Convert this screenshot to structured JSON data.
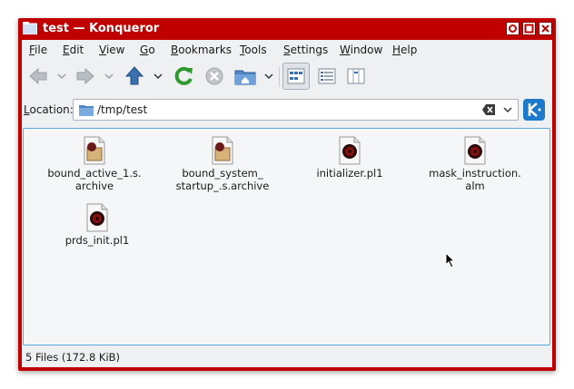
{
  "window": {
    "title": "test — Konqueror",
    "buttons": [
      "pin",
      "maximize",
      "close"
    ]
  },
  "menubar": {
    "items": [
      {
        "first": "F",
        "rest": "ile"
      },
      {
        "first": "E",
        "rest": "dit"
      },
      {
        "first": "V",
        "rest": "iew"
      },
      {
        "first": "G",
        "rest": "o"
      },
      {
        "first": "B",
        "rest": "ookmarks"
      },
      {
        "first": "T",
        "rest": "ools"
      },
      {
        "first": "S",
        "rest": "ettings"
      },
      {
        "first": "W",
        "rest": "indow"
      },
      {
        "first": "H",
        "rest": "elp"
      }
    ]
  },
  "toolbar": {
    "icons": [
      "back-arrow-icon",
      "forward-arrow-icon",
      "up-arrow-icon",
      "reload-icon",
      "stop-icon",
      "home-folder-icon",
      "icon-view-icon",
      "details-view-icon",
      "columns-view-icon"
    ]
  },
  "location": {
    "label_first": "L",
    "label_rest": "ocation:",
    "path": "/tmp/test"
  },
  "files": [
    {
      "name": "bound_active_1.s.\narchive",
      "type": "archive"
    },
    {
      "name": "bound_system_\nstartup_.s.archive",
      "type": "archive"
    },
    {
      "name": "initializer.pl1",
      "type": "script"
    },
    {
      "name": "mask_instruction.\nalm",
      "type": "script"
    },
    {
      "name": "prds_init.pl1",
      "type": "script"
    }
  ],
  "status": {
    "text": "5 Files (172.8 KiB)"
  },
  "colors": {
    "window_frame": "#c00000",
    "selection_border": "#5aa8e0",
    "reload_green": "#2e9a2e",
    "up_arrow_blue": "#3a6fb0"
  }
}
